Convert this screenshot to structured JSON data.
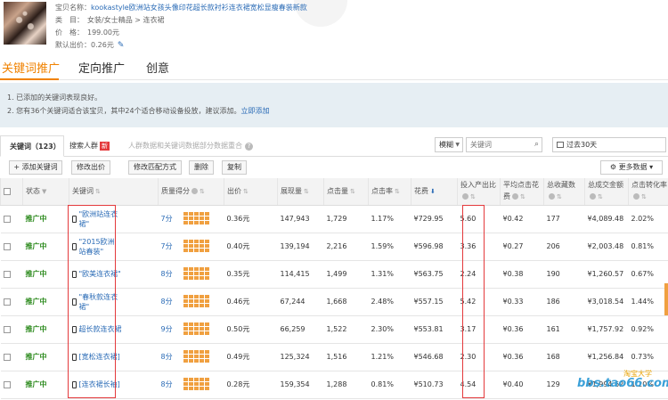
{
  "product": {
    "name_label": "宝贝名称：",
    "name": "kookastyle欧洲站女孩头像印花超长款衬衫连衣裙宽松显瘦春装新款",
    "category_label": "类　目：",
    "category": "女装/女士精品 > 连衣裙",
    "price_label": "价　格：",
    "price": "199.00元",
    "default_bid_label": "默认出价：",
    "default_bid": "0.26元"
  },
  "main_tabs": [
    "关键词推广",
    "定向推广",
    "创意"
  ],
  "notice": {
    "line1": "1. 已添加的关键词表现良好。",
    "line2": "2. 您有36个关键词适合该宝贝，其中24个适合移动设备投放，建议添加。",
    "line2_link": "立即添加"
  },
  "sub_tabs": {
    "keywords": "关键词（123）",
    "crowd": "搜索人群",
    "crowd_badge": "新",
    "hint": "人群数据和关键词数据部分数据重合"
  },
  "filters": {
    "match_select": "模糊",
    "search_placeholder": "关键词",
    "date_range": "过去30天"
  },
  "toolbar": {
    "add_keyword": "+ 添加关键词",
    "modify_bid": "修改出价",
    "modify_match": "修改匹配方式",
    "delete": "删除",
    "copy": "复制",
    "more_data": "更多数据"
  },
  "table": {
    "headers": {
      "status": "状态",
      "keyword": "关键词",
      "quality": "质量得分",
      "bid": "出价",
      "impressions": "展现量",
      "clicks": "点击量",
      "ctr": "点击率",
      "cost": "花费",
      "roi": "投入产出比",
      "avg_cpc": "平均点击花费",
      "favorites": "总收藏数",
      "gmv": "总成交金额",
      "cvr": "点击转化率"
    },
    "rows": [
      {
        "status": "推广中",
        "keyword": "\"欧洲站连衣裙\"",
        "quality": "7分",
        "bid": "0.36元",
        "impressions": "147,943",
        "clicks": "1,729",
        "ctr": "1.17%",
        "cost": "¥729.95",
        "roi": "5.60",
        "avg_cpc": "¥0.42",
        "favorites": "177",
        "gmv": "¥4,089.48",
        "cvr": "2.02%"
      },
      {
        "status": "推广中",
        "keyword": "\"2015欧洲站春装\"",
        "quality": "7分",
        "bid": "0.40元",
        "impressions": "139,194",
        "clicks": "2,216",
        "ctr": "1.59%",
        "cost": "¥596.98",
        "roi": "3.36",
        "avg_cpc": "¥0.27",
        "favorites": "206",
        "gmv": "¥2,003.48",
        "cvr": "0.81%"
      },
      {
        "status": "推广中",
        "keyword": "\"欧美连衣裙\"",
        "quality": "8分",
        "bid": "0.35元",
        "impressions": "114,415",
        "clicks": "1,499",
        "ctr": "1.31%",
        "cost": "¥563.75",
        "roi": "2.24",
        "avg_cpc": "¥0.38",
        "favorites": "190",
        "gmv": "¥1,260.57",
        "cvr": "0.67%"
      },
      {
        "status": "推广中",
        "keyword": "\"春秋款连衣裙\"",
        "quality": "8分",
        "bid": "0.46元",
        "impressions": "67,244",
        "clicks": "1,668",
        "ctr": "2.48%",
        "cost": "¥557.15",
        "roi": "5.42",
        "avg_cpc": "¥0.33",
        "favorites": "186",
        "gmv": "¥3,018.54",
        "cvr": "1.44%"
      },
      {
        "status": "推广中",
        "keyword": "超长款连衣裙",
        "quality": "9分",
        "bid": "0.50元",
        "impressions": "66,259",
        "clicks": "1,522",
        "ctr": "2.30%",
        "cost": "¥553.81",
        "roi": "3.17",
        "avg_cpc": "¥0.36",
        "favorites": "161",
        "gmv": "¥1,757.92",
        "cvr": "0.92%"
      },
      {
        "status": "推广中",
        "keyword": "[宽松连衣裙]",
        "quality": "8分",
        "bid": "0.49元",
        "impressions": "125,324",
        "clicks": "1,516",
        "ctr": "1.21%",
        "cost": "¥546.68",
        "roi": "2.30",
        "avg_cpc": "¥0.36",
        "favorites": "168",
        "gmv": "¥1,256.84",
        "cvr": "0.73%"
      },
      {
        "status": "推广中",
        "keyword": "[连衣裙长袖]",
        "quality": "8分",
        "bid": "0.28元",
        "impressions": "159,354",
        "clicks": "1,288",
        "ctr": "0.81%",
        "cost": "¥510.73",
        "roi": "4.54",
        "avg_cpc": "¥0.40",
        "favorites": "129",
        "gmv": "¥1,994.62",
        "cvr": "1.20%"
      }
    ]
  },
  "watermark": {
    "site": "bbs.tao66.com",
    "tag": "淘宝大学"
  },
  "colors": {
    "accent_orange": "#f08200",
    "link_blue": "#2a6bb6",
    "status_green": "#2e8b1f",
    "highlight_red": "#e4393c",
    "quality_bar_orange": "#f0a040"
  }
}
